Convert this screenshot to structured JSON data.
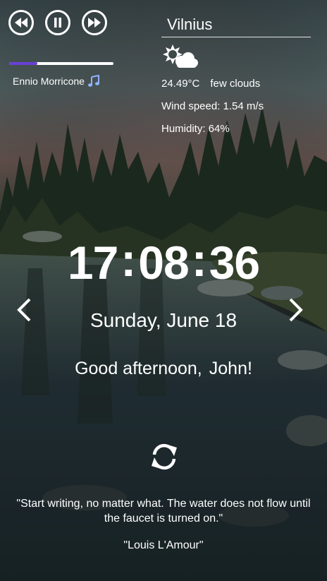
{
  "player": {
    "controls": [
      "previous",
      "pause",
      "next"
    ],
    "progress": 0.27,
    "track": "Ennio Morricone",
    "accent_color": "#6a3fd6"
  },
  "weather": {
    "city": "Vilnius",
    "icon": "few-clouds-icon",
    "temperature": "24.49°C",
    "description": "few clouds",
    "wind": "Wind speed: 1.54 m/s",
    "humidity": "Humidity: 64%"
  },
  "clock": {
    "hours": "17",
    "minutes": "08",
    "seconds": "36",
    "separator": ":"
  },
  "date": "Sunday, June 18",
  "greeting": {
    "text": "Good afternoon,",
    "name": "John!"
  },
  "quote": {
    "text": "\"Start writing, no matter what. The water does not flow until the faucet is turned on.\"",
    "author": "\"Louis L'Amour\""
  }
}
